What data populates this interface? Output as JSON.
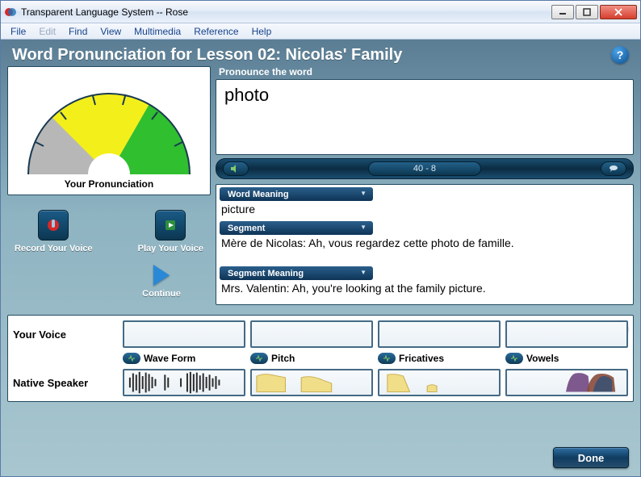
{
  "window_title": "Transparent Language System -- Rose",
  "menu": [
    "File",
    "Edit",
    "Find",
    "View",
    "Multimedia",
    "Reference",
    "Help"
  ],
  "menu_disabled": [
    1
  ],
  "page_title": "Word Pronunciation for Lesson 02: Nicolas' Family",
  "subhead": "Pronounce the word",
  "word": "photo",
  "gauge_label": "Your Pronunciation",
  "buttons": {
    "record": "Record Your Voice",
    "play": "Play Your Voice",
    "continue": "Continue",
    "done": "Done"
  },
  "nav_counter": "40 - 8",
  "sections": {
    "word_meaning_hdr": "Word Meaning",
    "word_meaning": "picture",
    "segment_hdr": "Segment",
    "segment": "Mère de Nicolas: Ah, vous regardez cette photo de famille.",
    "segment_meaning_hdr": "Segment Meaning",
    "segment_meaning": "Mrs. Valentin: Ah, you're looking at the family picture."
  },
  "voice_rows": {
    "your": "Your Voice",
    "native": "Native Speaker"
  },
  "voice_cols": [
    "Wave Form",
    "Pitch",
    "Fricatives",
    "Vowels"
  ],
  "help_glyph": "?",
  "colors": {
    "accent": "#0e3b58",
    "gauge_gray": "#b7b7b7",
    "gauge_yellow": "#f3ef1b",
    "gauge_green": "#2fbf2f"
  }
}
